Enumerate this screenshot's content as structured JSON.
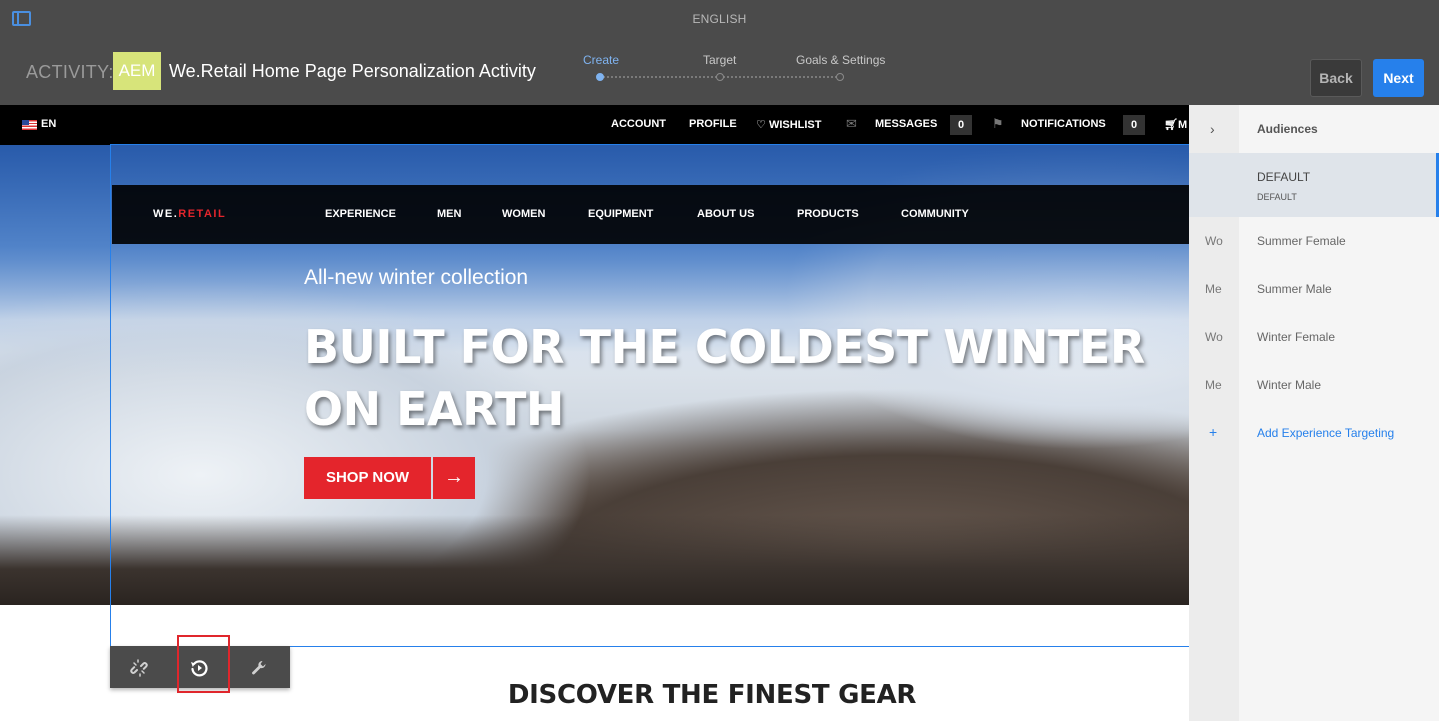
{
  "topbar": {
    "language": "ENGLISH",
    "activity_label": "ACTIVITY:",
    "badge": "AEM",
    "activity_title": "We.Retail Home Page Personalization Activity",
    "steps": [
      "Create",
      "Target",
      "Goals & Settings"
    ],
    "active_step": "Create",
    "back_label": "Back",
    "next_label": "Next",
    "accent_color": "#2680eb",
    "badge_color": "#d7e47a"
  },
  "site": {
    "language": "EN",
    "util": {
      "account": "ACCOUNT",
      "profile": "PROFILE",
      "wishlist": "WISHLIST",
      "messages": "MESSAGES",
      "messages_count": "0",
      "notifications": "NOTIFICATIONS",
      "notifications_count": "0",
      "cart": "M"
    },
    "logo_a": "WE.",
    "logo_b": "RETAIL",
    "nav": [
      "EXPERIENCE",
      "MEN",
      "WOMEN",
      "EQUIPMENT",
      "ABOUT US",
      "PRODUCTS",
      "COMMUNITY"
    ],
    "hero_sub": "All-new winter collection",
    "hero_title": "BUILT FOR THE COLDEST WINTER ON EARTH",
    "shop_label": "SHOP NOW",
    "discover": "DISCOVER THE FINEST GEAR",
    "brand_red": "#e4252c"
  },
  "component_toolbar": {
    "icons": [
      "unlink-icon",
      "revert-icon",
      "wrench-icon"
    ]
  },
  "audiences": {
    "title": "Audiences",
    "items": [
      {
        "abbr": "",
        "name": "DEFAULT",
        "sub": "DEFAULT",
        "selected": true
      },
      {
        "abbr": "Wo",
        "name": "Summer Female"
      },
      {
        "abbr": "Me",
        "name": "Summer Male"
      },
      {
        "abbr": "Wo",
        "name": "Winter Female"
      },
      {
        "abbr": "Me",
        "name": "Winter Male"
      }
    ],
    "add_label": "Add Experience Targeting",
    "add_symbol": "+"
  }
}
